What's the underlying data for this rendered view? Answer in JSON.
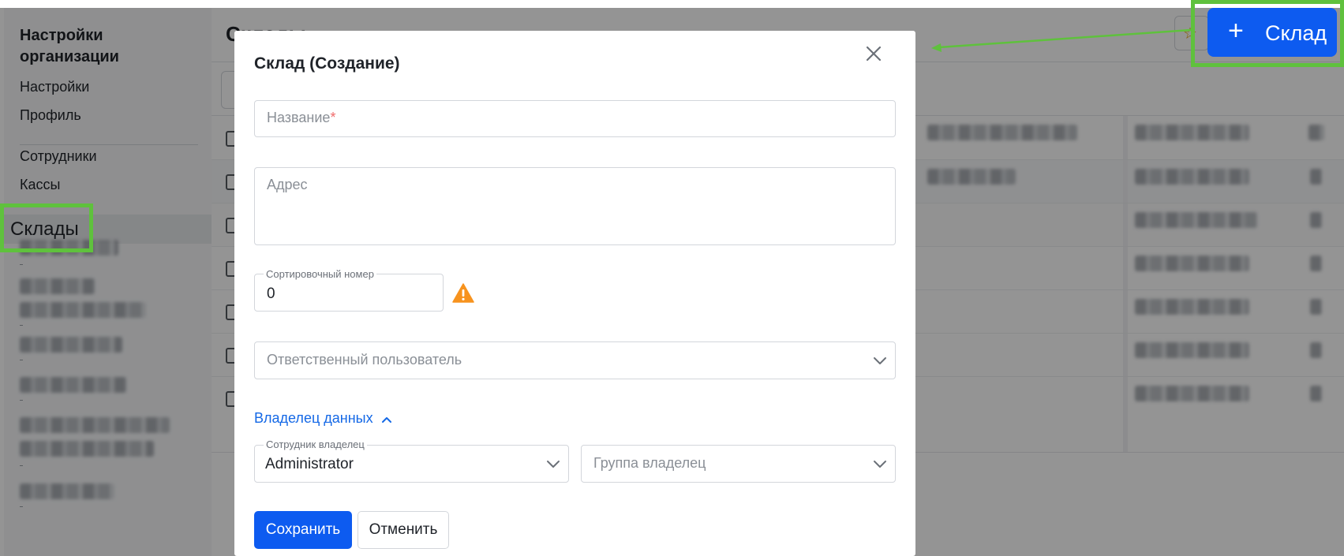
{
  "sidebar": {
    "title": "Настройки организации",
    "items": [
      {
        "label": "Настройки"
      },
      {
        "label": "Профиль"
      },
      {
        "label": "Сотрудники"
      },
      {
        "label": "Кассы"
      },
      {
        "label": "Склады",
        "active": true
      }
    ]
  },
  "main": {
    "page_title": "Склады",
    "create_button": {
      "icon": "plus-icon",
      "label": "Склад"
    },
    "favorite_icon": "star-icon"
  },
  "modal": {
    "title": "Склад (Создание)",
    "close_icon": "close-icon",
    "name_field": {
      "placeholder": "Название",
      "required_mark": "*"
    },
    "address_field": {
      "placeholder": "Адрес"
    },
    "sort_field": {
      "label": "Сортировочный номер",
      "value": "0"
    },
    "warning_icon": "warning-icon",
    "responsible_select": {
      "placeholder": "Ответственный пользователь"
    },
    "owner_section": {
      "label": "Владелец данных",
      "expanded": true
    },
    "owner_employee": {
      "label": "Сотрудник владелец",
      "value": "Administrator"
    },
    "owner_group": {
      "placeholder": "Группа владелец"
    },
    "save_label": "Сохранить",
    "cancel_label": "Отменить"
  },
  "colors": {
    "primary": "#0d5bf0",
    "link": "#1468e6",
    "warning": "#f7931e",
    "annotation": "#5fc13d",
    "required": "#f06b6b"
  }
}
